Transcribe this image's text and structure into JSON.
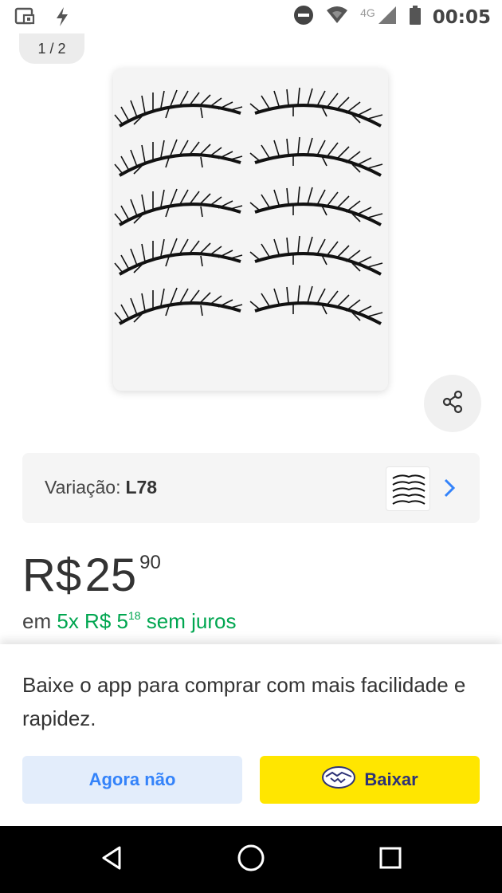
{
  "status_bar": {
    "time": "00:05",
    "network": "4G",
    "icons": [
      "screen-cast-icon",
      "flash-icon",
      "do-not-disturb-icon",
      "wifi-icon",
      "signal-icon",
      "battery-icon"
    ]
  },
  "gallery": {
    "counter": "1 / 2"
  },
  "variation": {
    "label": "Variação:",
    "value": "L78"
  },
  "price": {
    "currency": "R$",
    "integer": "25",
    "cents": "90"
  },
  "installments": {
    "prefix": "em",
    "count_price": "5x R$ 5",
    "cents": "18",
    "suffix": "sem juros"
  },
  "sheet": {
    "message": "Baixe o app para comprar com mais facilidade e rapidez.",
    "secondary_label": "Agora não",
    "primary_label": "Baixar"
  },
  "colors": {
    "accent_blue": "#3483fa",
    "accent_green": "#00a650",
    "brand_yellow": "#ffe600"
  }
}
